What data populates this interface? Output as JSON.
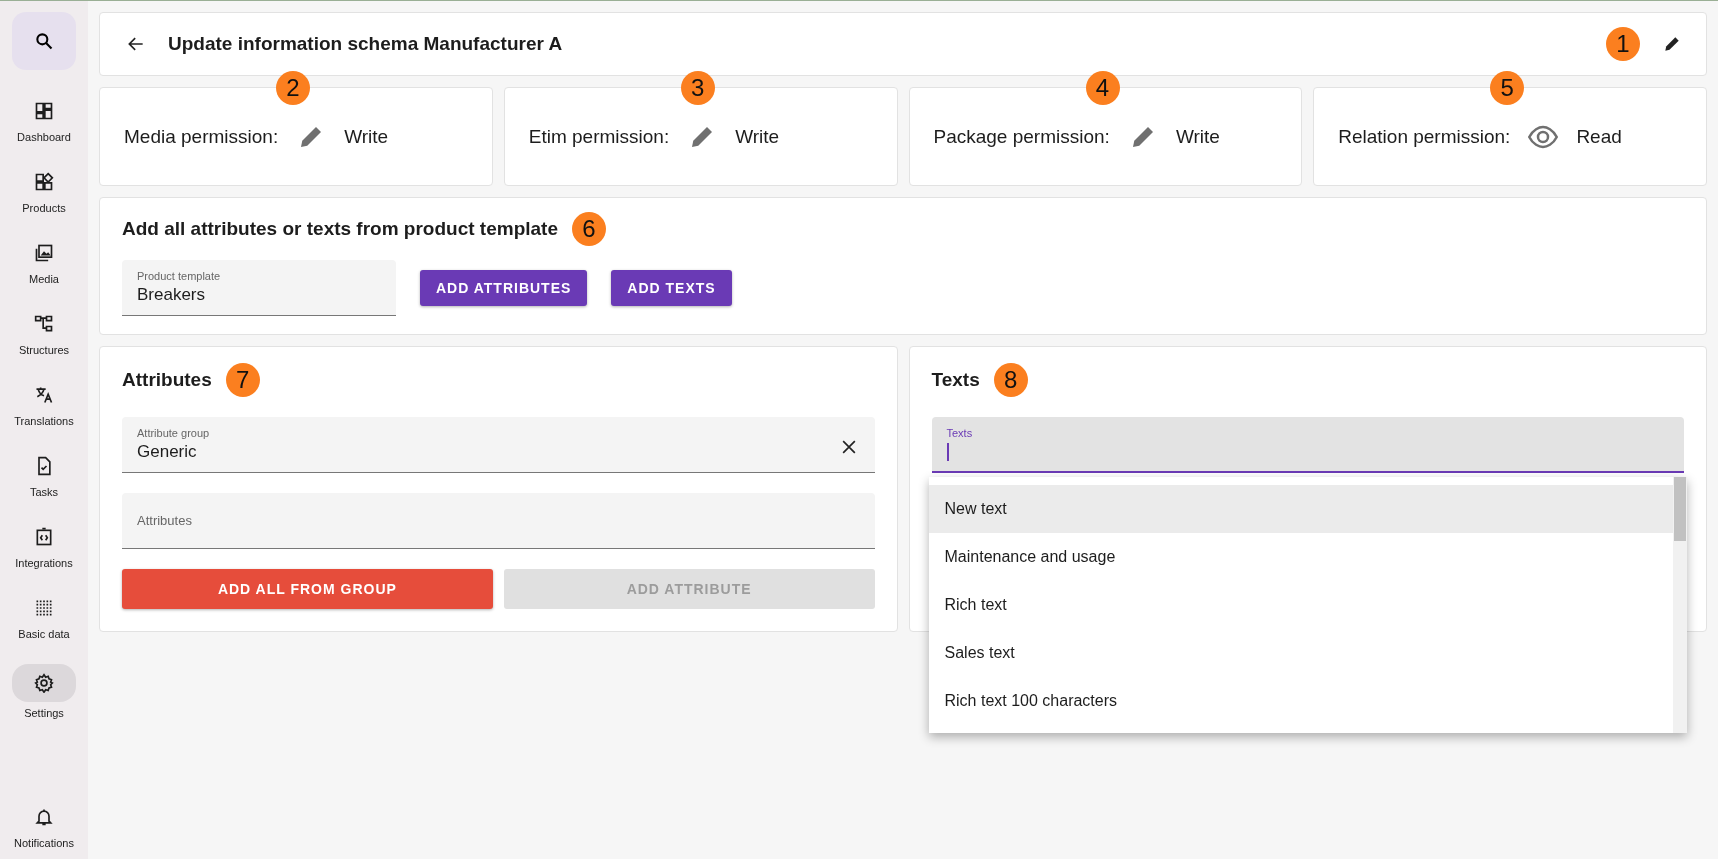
{
  "sidebar": {
    "search_selected": false,
    "items": [
      {
        "kind": "dashboard",
        "label": "Dashboard",
        "selected": false
      },
      {
        "kind": "products",
        "label": "Products",
        "selected": false
      },
      {
        "kind": "media",
        "label": "Media",
        "selected": false
      },
      {
        "kind": "structures",
        "label": "Structures",
        "selected": false
      },
      {
        "kind": "translations",
        "label": "Translations",
        "selected": false
      },
      {
        "kind": "tasks",
        "label": "Tasks",
        "selected": false
      },
      {
        "kind": "integrations",
        "label": "Integrations",
        "selected": false
      },
      {
        "kind": "basic-data",
        "label": "Basic data",
        "selected": false
      },
      {
        "kind": "settings",
        "label": "Settings",
        "selected": true
      }
    ],
    "bottom_item": {
      "kind": "notifications",
      "label": "Notifications"
    }
  },
  "header": {
    "title": "Update information schema Manufacturer A",
    "marker": "1"
  },
  "permissions": [
    {
      "label": "Media permission:",
      "kind": "write",
      "value": "Write",
      "marker": "2"
    },
    {
      "label": "Etim permission:",
      "kind": "write",
      "value": "Write",
      "marker": "3"
    },
    {
      "label": "Package permission:",
      "kind": "write",
      "value": "Write",
      "marker": "4"
    },
    {
      "label": "Relation permission:",
      "kind": "read",
      "value": "Read",
      "marker": "5"
    }
  ],
  "template": {
    "title": "Add all attributes or texts from product template",
    "marker": "6",
    "field": {
      "label": "Product template",
      "value": "Breakers"
    },
    "buttons": [
      "ADD ATTRIBUTES",
      "ADD TEXTS"
    ]
  },
  "attributes": {
    "title": "Attributes",
    "marker": "7",
    "group_field": {
      "label": "Attribute group",
      "value": "Generic"
    },
    "attributes_field": {
      "placeholder": "Attributes"
    },
    "buttons": [
      {
        "label": "ADD ALL FROM GROUP",
        "disabled": false
      },
      {
        "label": "ADD ATTRIBUTE",
        "disabled": true
      }
    ]
  },
  "texts": {
    "title": "Texts",
    "marker": "8",
    "field": {
      "label": "Texts",
      "focused": true
    },
    "options": [
      {
        "label": "New text",
        "highlighted": true
      },
      {
        "label": "Maintenance and usage",
        "highlighted": false
      },
      {
        "label": "Rich text",
        "highlighted": false
      },
      {
        "label": "Sales text",
        "highlighted": false
      },
      {
        "label": "Rich text 100 characters",
        "highlighted": false
      }
    ]
  }
}
